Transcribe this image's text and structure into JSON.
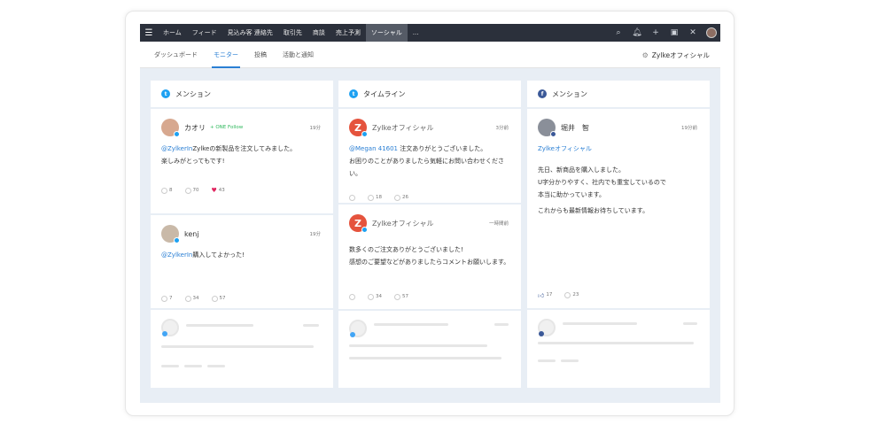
{
  "topnav": {
    "items": [
      "ホーム",
      "フィード",
      "見込み客 連絡先",
      "取引先",
      "商談",
      "売上予測",
      "ソーシャル",
      "..."
    ],
    "active_index": 6
  },
  "subtabs": {
    "items": [
      "ダッシュボード",
      "モニター",
      "投稿",
      "活動と通知"
    ],
    "active_index": 1,
    "brand_label": "Zylkeオフィシャル"
  },
  "columns": [
    {
      "title": "メンション",
      "source": "twitter",
      "posts": [
        {
          "author": "カオリ",
          "follow": "+ ONE Follow",
          "time": "19分",
          "mention": "@ZylkerIn",
          "text": "Zylkeの新製品を注文してみました。",
          "text2": "楽しみがとってもです!",
          "stats": [
            "8",
            "70",
            "43"
          ]
        },
        {
          "author": "kenj",
          "time": "19分",
          "mention": "@ZylkerIn",
          "text": "購入してよかった!",
          "stats": [
            "7",
            "34",
            "57"
          ]
        }
      ]
    },
    {
      "title": "タイムライン",
      "source": "twitter",
      "posts": [
        {
          "author": "Zylkeオフィシャル",
          "time": "3分前",
          "mention": "@Megan 41601",
          "text": " 注文ありがとうございました。",
          "text2": "お困りのことがありましたら気軽にお問い合わせください。",
          "stats": [
            "18",
            "26"
          ]
        },
        {
          "author": "Zylkeオフィシャル",
          "time": "一時間前",
          "text": "数多くのご注文ありがとうございました!",
          "text2": "感想のご要望などがありましたらコメントお願いします。",
          "stats": [
            "34",
            "57"
          ]
        }
      ]
    },
    {
      "title": "メンション",
      "source": "facebook",
      "posts": [
        {
          "author": "堀井　智",
          "time": "19分前",
          "mention": "Zylkeオフィシャル",
          "text": "先日、新商品を購入しました。",
          "text2": "U字分かりやすく、社内でも重宝しているので",
          "text3": "本当に助かっています。",
          "text4": "これからも最新情報お待ちしています。",
          "stats": [
            "17",
            "23"
          ]
        }
      ]
    }
  ],
  "colors": {
    "topbar": "#2b303b",
    "accent": "#2a7fd4",
    "twitter": "#1da1f2",
    "facebook": "#3b5998",
    "board": "#e8eef5"
  }
}
